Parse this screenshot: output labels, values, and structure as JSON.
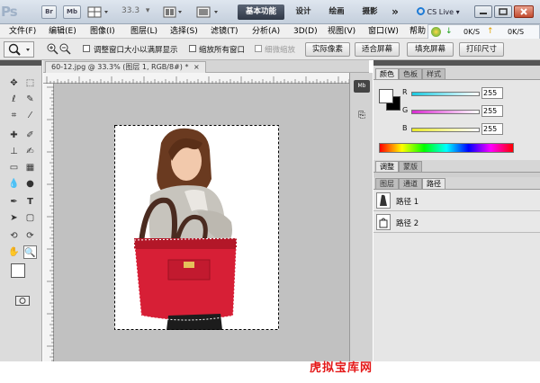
{
  "appbar": {
    "logo": "Ps",
    "br_label": "Br",
    "mb_label": "Mb",
    "zoom_value": "33.3",
    "workspaces": [
      "基本功能",
      "设计",
      "绘画",
      "摄影"
    ],
    "more": "»",
    "cslive": "CS Live",
    "colors": {
      "accent": "#2f3846"
    }
  },
  "menubar": {
    "items": [
      "文件(F)",
      "编辑(E)",
      "图像(I)",
      "图层(L)",
      "选择(S)",
      "滤镜(T)",
      "分析(A)",
      "3D(D)",
      "视图(V)",
      "窗口(W)",
      "帮助"
    ]
  },
  "netmeter": {
    "down": "0K/S",
    "up": "0K/S"
  },
  "optbar": {
    "resize_label": "调整窗口大小以满屏显示",
    "zoom_all_label": "缩放所有窗口",
    "scrubby_label": "细微缩放",
    "actual_pixels": "实际像素",
    "fit_screen": "适合屏幕",
    "fill_screen": "填充屏幕",
    "print_size": "打印尺寸"
  },
  "document": {
    "tab_title": "60-12.jpg @ 33.3% (图层 1, RGB/8#) *",
    "close": "×"
  },
  "color_panel": {
    "tabs": [
      "颜色",
      "色板",
      "样式"
    ],
    "channels": [
      {
        "name": "R",
        "value": "255",
        "color": "#19c9e0"
      },
      {
        "name": "G",
        "value": "255",
        "color": "#d82ad0"
      },
      {
        "name": "B",
        "value": "255",
        "color": "#e9e92a"
      }
    ]
  },
  "adjust_panel": {
    "tabs": [
      "调整",
      "蒙版"
    ]
  },
  "paths_panel": {
    "tabs": [
      "图层",
      "通道",
      "路径"
    ],
    "items": [
      {
        "name": "路径 1"
      },
      {
        "name": "路径 2"
      }
    ]
  },
  "watermark": {
    "text": "虎拟宝库网"
  }
}
